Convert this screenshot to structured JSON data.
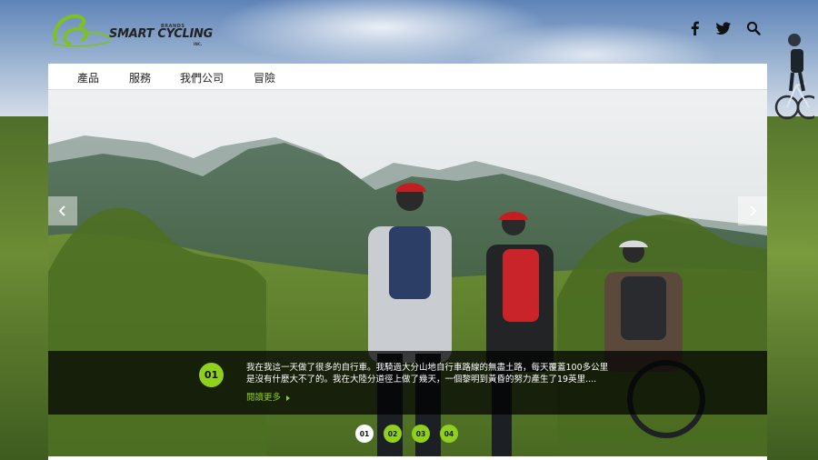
{
  "brand": {
    "name": "SMART CYCLING",
    "top_text": "BRANDS",
    "suffix": "INC.",
    "accent_color": "#8fd01f"
  },
  "header": {
    "icons": [
      "facebook-icon",
      "twitter-icon",
      "search-icon"
    ]
  },
  "nav": {
    "items": [
      {
        "label": "產品"
      },
      {
        "label": "服務"
      },
      {
        "label": "我們公司"
      },
      {
        "label": "冒險"
      }
    ]
  },
  "slider": {
    "caption": {
      "number": "01",
      "line1": "我在我這一天做了很多的自行車。我騎過大分山地自行車路線的無盡土路，每天覆蓋100多公里",
      "line2": "是沒有什麼大不了的。我在大陸分道徑上做了幾天，一個黎明到黃昏的努力產生了19英里....",
      "read_more": "閱讀更多"
    },
    "pagination": [
      {
        "label": "01",
        "active": true
      },
      {
        "label": "02",
        "active": false
      },
      {
        "label": "03",
        "active": false
      },
      {
        "label": "04",
        "active": false
      }
    ]
  }
}
